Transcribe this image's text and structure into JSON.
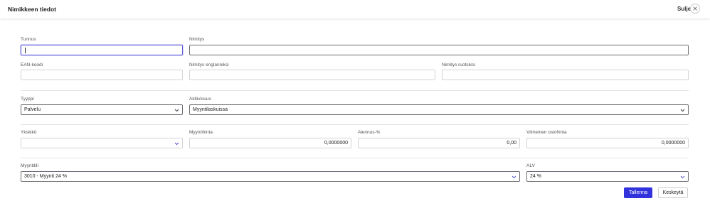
{
  "dialog": {
    "title": "Nimikkeen tiedot",
    "close_label": "Sulje"
  },
  "form": {
    "tunnus": {
      "label": "Tunnus",
      "value": ""
    },
    "nimitys": {
      "label": "Nimitys",
      "value": ""
    },
    "ean": {
      "label": "EAN-koodi",
      "value": ""
    },
    "nimitys_en": {
      "label": "Nimitys englanniksi",
      "value": ""
    },
    "nimitys_sv": {
      "label": "Nimitys ruotsiksi",
      "value": ""
    },
    "tyyppi": {
      "label": "Tyyppi",
      "value": "Palvelu"
    },
    "aktiivisuus": {
      "label": "Aktiivisuus",
      "value": "Myyntilaskuissa"
    },
    "yksikko": {
      "label": "Yksikkö",
      "value": ""
    },
    "myyntihinta": {
      "label": "Myyntihinta",
      "value": "0,0000000"
    },
    "alennus": {
      "label": "Alennus-%",
      "value": "0,00"
    },
    "ostohinta": {
      "label": "Viimeinen ostohinta",
      "value": "0,0000000"
    },
    "myyntitili": {
      "label": "Myyntitili",
      "value": "3010 - Myynti 24 %"
    },
    "alv": {
      "label": "ALV",
      "value": "24 %"
    }
  },
  "buttons": {
    "save": "Tallenna",
    "cancel": "Keskeytä"
  },
  "colors": {
    "accent": "#3333dd",
    "focus": "#5a5ad6",
    "chevron": "#4a4ad0"
  }
}
